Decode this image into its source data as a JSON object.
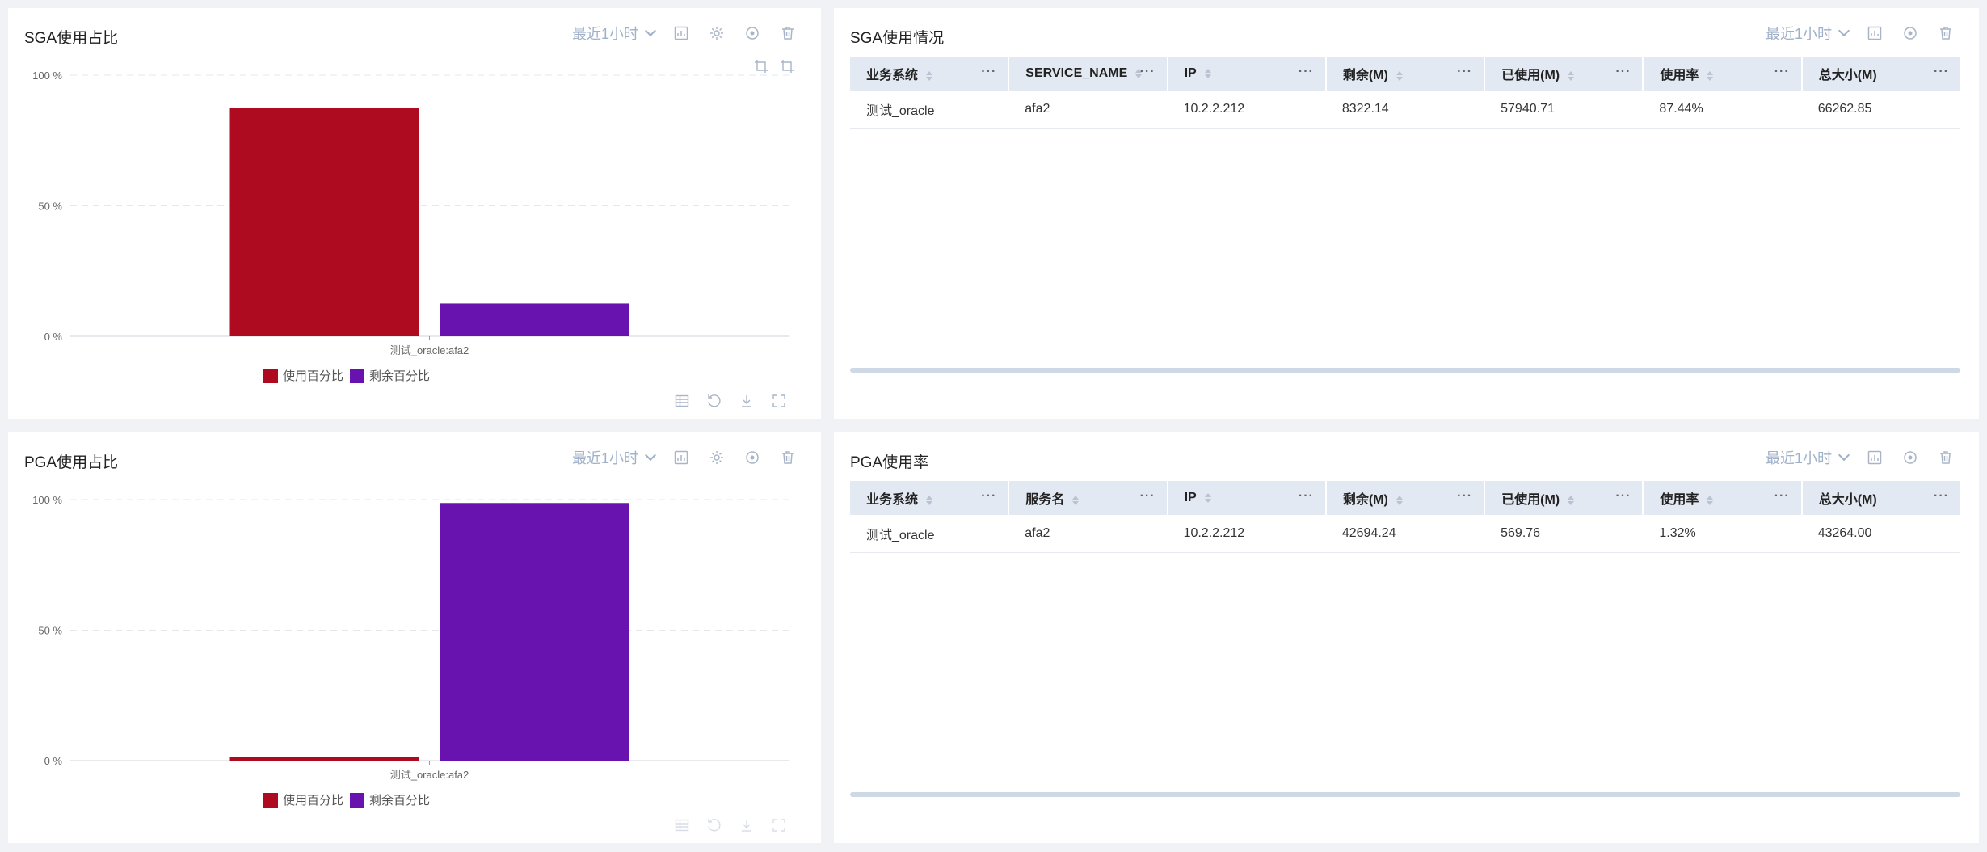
{
  "colors": {
    "used": "#ae0b21",
    "remaining": "#6812b0",
    "header_bg": "#e3e9f2",
    "tool": "#a9b5c7"
  },
  "time_range": "最近1小时",
  "sga_chart": {
    "title": "SGA使用占比",
    "legend": [
      "使用百分比",
      "剩余百分比"
    ]
  },
  "pga_chart": {
    "title": "PGA使用占比",
    "legend": [
      "使用百分比",
      "剩余百分比"
    ]
  },
  "chart_data": [
    {
      "type": "bar",
      "title": "SGA使用占比",
      "categories": [
        "测试_oracle:afa2"
      ],
      "series": [
        {
          "name": "使用百分比",
          "values": [
            87.44
          ]
        },
        {
          "name": "剩余百分比",
          "values": [
            12.56
          ]
        }
      ],
      "ylim": [
        0,
        100
      ],
      "yticks": [
        "0 %",
        "50 %",
        "100 %"
      ],
      "grid": true,
      "legend_position": "bottom"
    },
    {
      "type": "bar",
      "title": "PGA使用占比",
      "categories": [
        "测试_oracle:afa2"
      ],
      "series": [
        {
          "name": "使用百分比",
          "values": [
            1.32
          ]
        },
        {
          "name": "剩余百分比",
          "values": [
            98.68
          ]
        }
      ],
      "ylim": [
        0,
        100
      ],
      "yticks": [
        "0 %",
        "50 %",
        "100 %"
      ],
      "grid": true,
      "legend_position": "bottom"
    }
  ],
  "sga_table": {
    "title": "SGA使用情况",
    "columns": [
      "业务系统",
      "SERVICE_NAME",
      "IP",
      "剩余(M)",
      "已使用(M)",
      "使用率",
      "总大小(M)"
    ],
    "rows": [
      [
        "测试_oracle",
        "afa2",
        "10.2.2.212",
        "8322.14",
        "57940.71",
        "87.44%",
        "66262.85"
      ]
    ]
  },
  "pga_table": {
    "title": "PGA使用率",
    "columns": [
      "业务系统",
      "服务名",
      "IP",
      "剩余(M)",
      "已使用(M)",
      "使用率",
      "总大小(M)"
    ],
    "rows": [
      [
        "测试_oracle",
        "afa2",
        "10.2.2.212",
        "42694.24",
        "569.76",
        "1.32%",
        "43264.00"
      ]
    ]
  }
}
